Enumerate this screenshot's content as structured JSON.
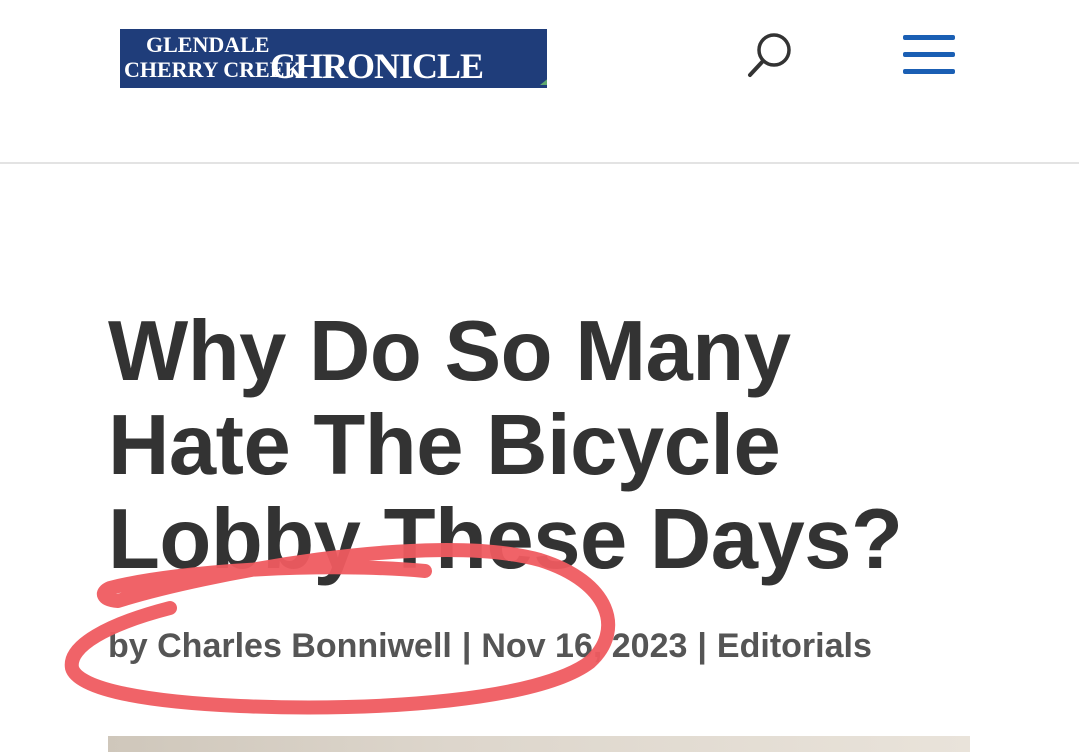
{
  "header": {
    "logo": {
      "line1": "Glendale",
      "line2": "Cherry Creek",
      "big": "Chronicle"
    },
    "search_icon": "search-icon",
    "menu_icon": "hamburger-menu-icon",
    "accent_color": "#1a5fb4"
  },
  "article": {
    "title": "Why Do So Many Hate The Bicycle Lobby These Days?",
    "meta": {
      "author": "by Charles Bonniwell",
      "separator": "|",
      "date": "Nov 16, 2023",
      "category": "Editorials"
    }
  },
  "annotation": {
    "type": "red-hand-drawn-circle",
    "color": "#ef5b60"
  }
}
